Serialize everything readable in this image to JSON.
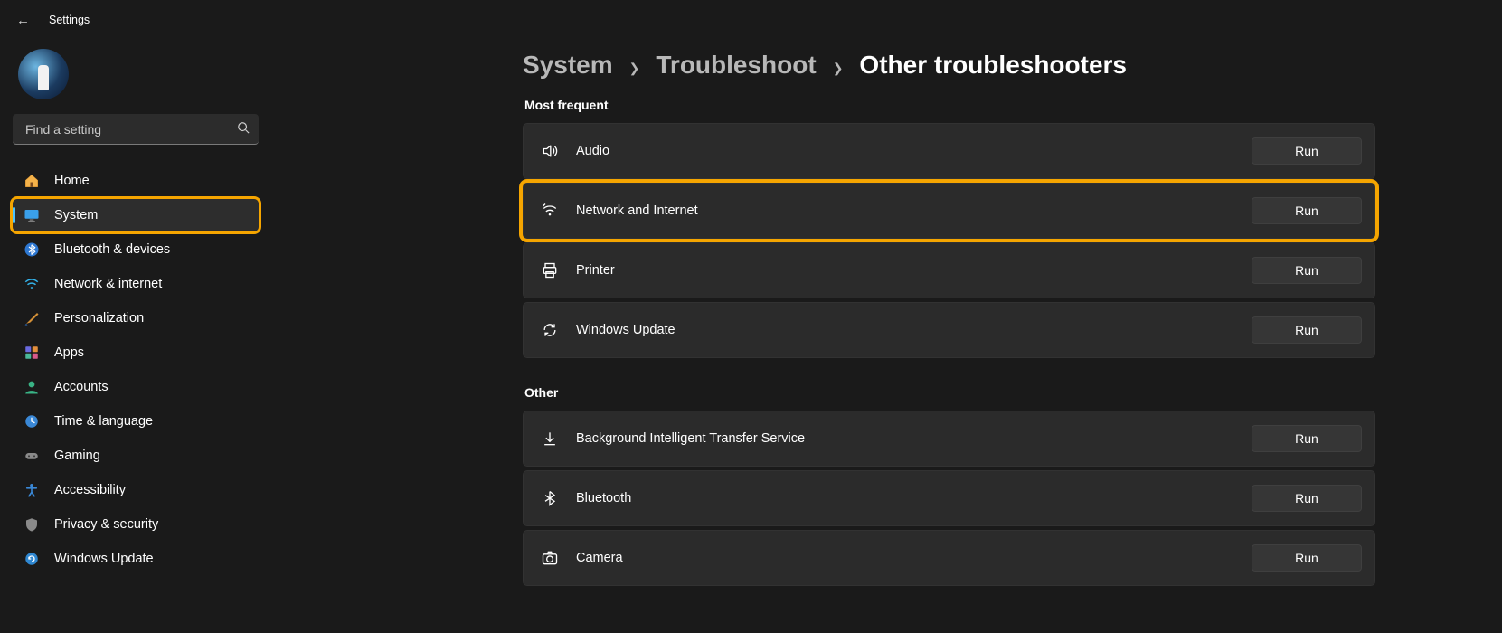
{
  "titlebar": {
    "title": "Settings"
  },
  "search": {
    "placeholder": "Find a setting"
  },
  "sidebar": {
    "items": [
      {
        "id": "home",
        "label": "Home",
        "selected": false
      },
      {
        "id": "system",
        "label": "System",
        "selected": true,
        "highlight": true
      },
      {
        "id": "bluetooth",
        "label": "Bluetooth & devices",
        "selected": false
      },
      {
        "id": "network",
        "label": "Network & internet",
        "selected": false
      },
      {
        "id": "personalization",
        "label": "Personalization",
        "selected": false
      },
      {
        "id": "apps",
        "label": "Apps",
        "selected": false
      },
      {
        "id": "accounts",
        "label": "Accounts",
        "selected": false
      },
      {
        "id": "time",
        "label": "Time & language",
        "selected": false
      },
      {
        "id": "gaming",
        "label": "Gaming",
        "selected": false
      },
      {
        "id": "accessibility",
        "label": "Accessibility",
        "selected": false
      },
      {
        "id": "privacy",
        "label": "Privacy & security",
        "selected": false
      },
      {
        "id": "winupdate",
        "label": "Windows Update",
        "selected": false
      }
    ]
  },
  "breadcrumb": {
    "level1": "System",
    "level2": "Troubleshoot",
    "level3": "Other troubleshooters"
  },
  "sections": {
    "most_frequent": {
      "header": "Most frequent",
      "items": [
        {
          "id": "audio",
          "label": "Audio",
          "run": "Run"
        },
        {
          "id": "network",
          "label": "Network and Internet",
          "run": "Run",
          "highlight": true
        },
        {
          "id": "printer",
          "label": "Printer",
          "run": "Run"
        },
        {
          "id": "winupdate",
          "label": "Windows Update",
          "run": "Run"
        }
      ]
    },
    "other": {
      "header": "Other",
      "items": [
        {
          "id": "bits",
          "label": "Background Intelligent Transfer Service",
          "run": "Run"
        },
        {
          "id": "bluetooth",
          "label": "Bluetooth",
          "run": "Run"
        },
        {
          "id": "camera",
          "label": "Camera",
          "run": "Run"
        }
      ]
    }
  }
}
